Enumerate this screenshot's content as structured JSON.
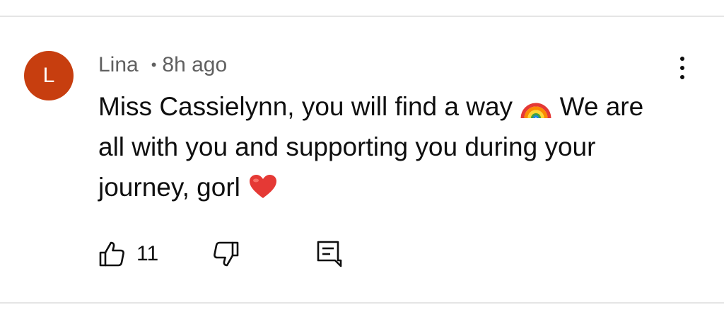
{
  "comment": {
    "author": "Lina",
    "separator": "•",
    "time": "8h ago",
    "avatar_initial": "L",
    "avatar_color": "#c73e0f",
    "text_parts": {
      "p1": "Miss Cassielynn, you will find a way ",
      "p2": " We are all with you and supporting you during your journey, gorl "
    },
    "emojis": [
      "rainbow-emoji",
      "red-heart-emoji"
    ],
    "likes": "11"
  },
  "icons": {
    "more": "more-vertical-icon",
    "like": "thumbs-up-icon",
    "dislike": "thumbs-down-icon",
    "reply": "reply-comment-icon"
  },
  "colors": {
    "text": "#0f0f0f",
    "meta": "#606060",
    "divider": "#e5e5e5"
  }
}
